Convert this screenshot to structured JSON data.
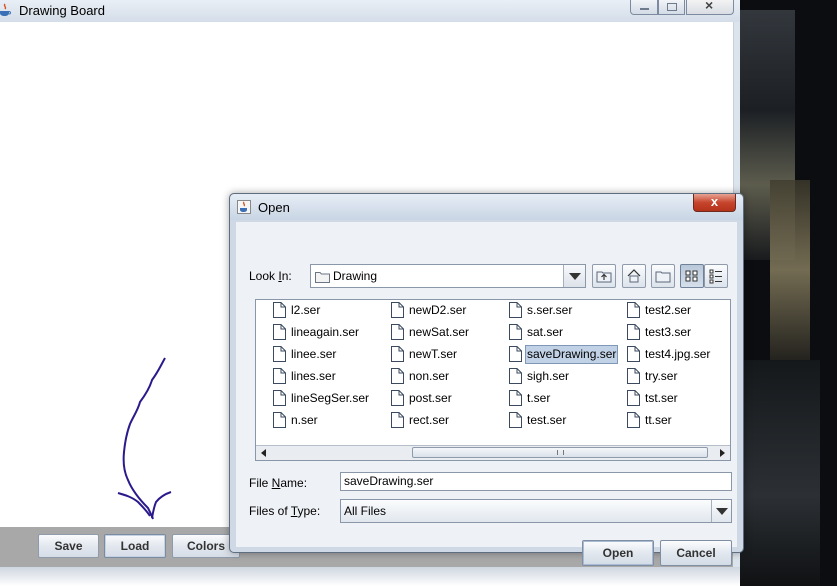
{
  "main_window": {
    "title": "Drawing Board",
    "buttons": {
      "save": "Save",
      "load": "Load",
      "colors": "Colors"
    },
    "close_glyph": "×"
  },
  "dialog": {
    "title": "Open",
    "close_glyph": "x",
    "look_in_label_pre": "Look ",
    "look_in_label_mnemonic": "I",
    "look_in_label_post": "n:",
    "look_in_value": "Drawing",
    "file_name_label_pre": "File ",
    "file_name_label_mnemonic": "N",
    "file_name_label_post": "ame:",
    "file_name_value": "saveDrawing.ser",
    "files_of_type_label_pre": "Files of ",
    "files_of_type_label_mnemonic": "T",
    "files_of_type_label_post": "ype:",
    "files_of_type_value": "All Files",
    "open_button": "Open",
    "cancel_button": "Cancel",
    "toolbar_icons": [
      "up-one-level-icon",
      "home-icon",
      "new-folder-icon",
      "list-view-icon",
      "details-view-icon"
    ],
    "files": {
      "col1": [
        "l2.ser",
        "lineagain.ser",
        "linee.ser",
        "lines.ser",
        "lineSegSer.ser",
        "n.ser"
      ],
      "col2": [
        "newD2.ser",
        "newSat.ser",
        "newT.ser",
        "non.ser",
        "post.ser",
        "rect.ser"
      ],
      "col3": [
        "s.ser.ser",
        "sat.ser",
        "saveDrawing.ser",
        "sigh.ser",
        "t.ser",
        "test.ser"
      ],
      "col4": [
        "test2.ser",
        "test3.ser",
        "test4.jpg.ser",
        "try.ser",
        "tst.ser",
        "tt.ser"
      ]
    },
    "selected_file": "saveDrawing.ser"
  },
  "colors": {
    "annotation_arrow": "#2a1a8c",
    "selection": "#c2d2e6",
    "dialog_close": "#c7452d"
  }
}
